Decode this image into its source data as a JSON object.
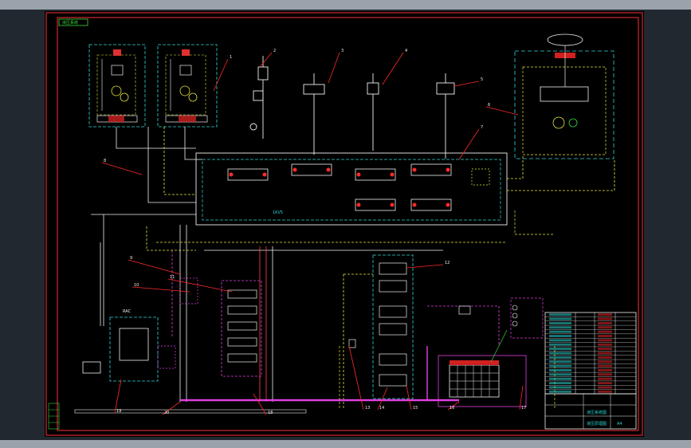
{
  "drawing": {
    "corner_tag": "液压系统",
    "panel": {
      "label": "RAC"
    },
    "mid_block_label": "1KV5"
  },
  "title_block": {
    "rows": [
      "",
      "",
      "",
      "",
      "",
      "",
      "",
      "",
      "",
      "",
      "",
      "",
      "",
      "",
      "",
      "",
      "",
      "",
      ""
    ],
    "stamp_1": "液压系统图",
    "stamp_2": "液压原理图",
    "stamp_3": "A4"
  },
  "leaders": [
    {
      "id": "leader-1",
      "text": "1"
    },
    {
      "id": "leader-2",
      "text": "2"
    },
    {
      "id": "leader-3",
      "text": "3"
    },
    {
      "id": "leader-4",
      "text": "4"
    },
    {
      "id": "leader-5",
      "text": "5"
    },
    {
      "id": "leader-6",
      "text": "6"
    },
    {
      "id": "leader-7",
      "text": "7"
    },
    {
      "id": "leader-8",
      "text": "8"
    },
    {
      "id": "leader-9",
      "text": "9"
    },
    {
      "id": "leader-10",
      "text": "10"
    },
    {
      "id": "leader-11",
      "text": "11"
    },
    {
      "id": "leader-12",
      "text": "12"
    },
    {
      "id": "leader-13",
      "text": "13"
    },
    {
      "id": "leader-14",
      "text": "14"
    },
    {
      "id": "leader-15",
      "text": "15"
    },
    {
      "id": "leader-16",
      "text": "16"
    },
    {
      "id": "leader-17",
      "text": "17"
    },
    {
      "id": "leader-18",
      "text": "18"
    },
    {
      "id": "leader-19",
      "text": "19"
    },
    {
      "id": "leader-20",
      "text": "20"
    }
  ],
  "colors": {
    "background": "#000000",
    "frame": "#ff3030",
    "cyan": "#2fd6d6",
    "yellow": "#e6e63a",
    "green": "#3ad83a",
    "magenta": "#e040e0",
    "white": "#f0f0f0",
    "red": "#ff2a2a"
  }
}
